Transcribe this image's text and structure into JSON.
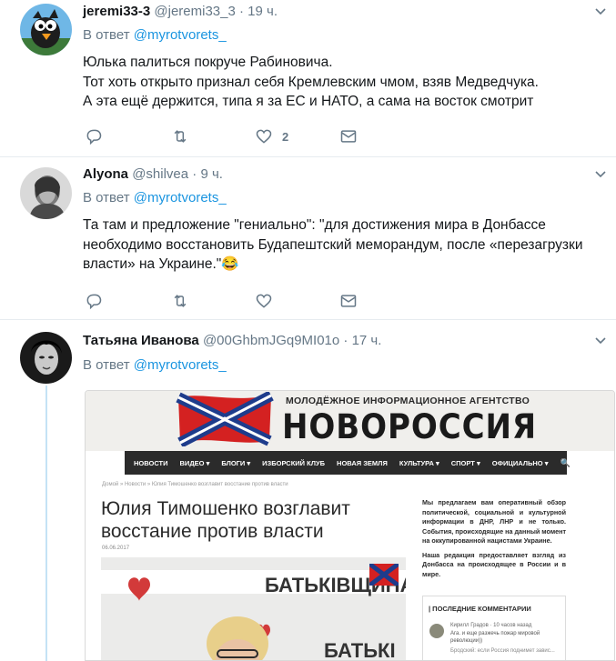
{
  "tweets": [
    {
      "name": "jeremi33-3",
      "handle": "@jeremi33_3",
      "time": "· 19 ч.",
      "reply_prefix": "В ответ",
      "reply_to": "@myrotvorets_",
      "lines": [
        "Юлька палиться покруче Рабиновича.",
        "Тот хоть открыто признал себя Кремлевским чмом, взяв Медведчука.",
        "А эта ещё держится, типа я за ЕС и НАТО, а сама на восток смотрит"
      ],
      "like_count": "2"
    },
    {
      "name": "Alyona",
      "handle": "@shilvea",
      "time": "· 9 ч.",
      "reply_prefix": "В ответ",
      "reply_to": "@myrotvorets_",
      "lines": [
        "Та там и предложение \"гениально\": \"для достижения мира в Донбассе",
        "необходимо восстановить Будапештский меморандум, после «перезагрузки",
        "власти» на Украине.\"😂"
      ],
      "like_count": ""
    },
    {
      "name": "Татьяна Иванова",
      "handle": "@00GhbmJGq9MI01o",
      "time": "· 17 ч.",
      "reply_prefix": "В ответ",
      "reply_to": "@myrotvorets_",
      "lines": []
    }
  ],
  "embedded": {
    "agency_small": "МОЛОДЁЖНОЕ ИНФОРМАЦИОННОЕ АГЕНТСТВО",
    "agency_big": "НОВОРОССИЯ",
    "nav": [
      "НОВОСТИ",
      "ВИДЕО ▾",
      "БЛОГИ ▾",
      "ИЗБОРСКИЙ КЛУБ",
      "НОВАЯ ЗЕМЛЯ",
      "КУЛЬТУРА ▾",
      "СПОРТ ▾",
      "ОФИЦИАЛЬНО ▾"
    ],
    "search_glyph": "🔍",
    "breadcrumbs": "Домой » Новости » Юлия Тимошенко возглавит восстание против власти",
    "headline_1": "Юлия Тимошенко возглавит",
    "headline_2": "восстание против власти",
    "date": "06.06.2017",
    "side_p1": "Мы предлагаем вам оперативный обзор политической, социальной и культурной информации в ДНР, ЛНР и не только. События, происходящие на данный момент на оккупированной нацистами Украине.",
    "side_p2": "Наша редакция предоставляет взгляд из Донбасса на происходящее в России и в мире.",
    "comments_title": "| ПОСЛЕДНИЕ КОММЕНТАРИИ",
    "comment_author": "Кирилл Градов · 10 часов назад",
    "comment_text": "Ага. и еще разжечь пожар мировой революции))",
    "comment_text2": "Бродский: если Россия поднимет завис...",
    "photo_banner_1": "БАТЬКІВЩИНА",
    "photo_banner_2": "БАТЬКІ"
  },
  "colors": {
    "link": "#1b95e0",
    "muted": "#657786",
    "text": "#14171a",
    "thread_line": "#c4e2f5"
  }
}
